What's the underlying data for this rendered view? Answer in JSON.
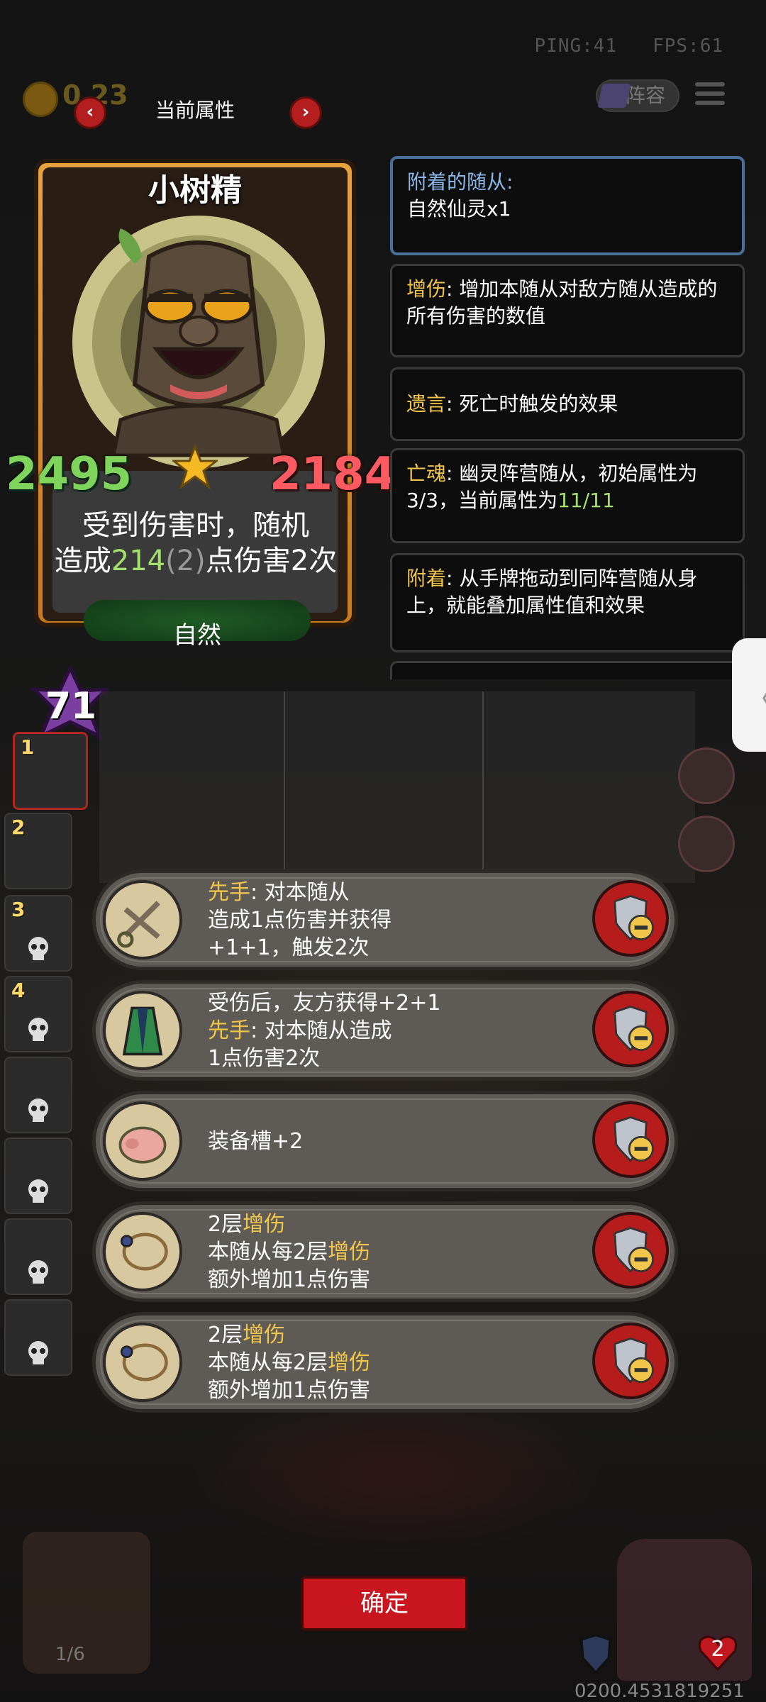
{
  "status": {
    "ping": "PING:41",
    "fps": "FPS:61",
    "coins": "0 23"
  },
  "header": {
    "title": "当前属性",
    "prev_arrow": "‹",
    "next_arrow": "›",
    "lineup": "阵容"
  },
  "card": {
    "name": "小树精",
    "desc_line1": "受到伤害时，随机",
    "desc_pre": "造成",
    "desc_dmg": "214",
    "desc_base": "(2)",
    "desc_post": "点伤害2次",
    "attack": "2495",
    "health": "2184",
    "tribe": "自然",
    "level": "71",
    "star_count": 1
  },
  "keywords": [
    {
      "key": "附着的随从:",
      "text": "自然仙灵x1"
    },
    {
      "key": "增伤",
      "text": ": 增加本随从对敌方随从造成的所有伤害的数值"
    },
    {
      "key": "遗言",
      "text": ": 死亡时触发的效果"
    },
    {
      "key": "亡魂",
      "text": ": 幽灵阵营随从，初始属性为3/3，当前属性为",
      "value": "11/11"
    },
    {
      "key": "附着",
      "text": ": 从手牌拖动到同阵营随从身上，就能叠加属性值和效果"
    }
  ],
  "side_tab": "〈",
  "slots": [
    "1",
    "2",
    "3",
    "4",
    "",
    "",
    "",
    ""
  ],
  "equipment": [
    {
      "icon": "scissors-icon",
      "l1k": "先手",
      "l1": ": 对本随从",
      "l2": "造成1点伤害并获得",
      "l3": "+1+1，触发2次"
    },
    {
      "icon": "robe-icon",
      "l1k": "",
      "l1": "受伤后，友方获得+2+1",
      "l2k": "先手",
      "l2": ": 对本随从造成",
      "l3": "1点伤害2次"
    },
    {
      "icon": "pig-icon",
      "l1k": "",
      "l1": "装备槽+2"
    },
    {
      "icon": "necklace-icon",
      "l1": "2层",
      "l1k2": "增伤",
      "l2": "本随从每2层",
      "l2k2": "增伤",
      "l3": "额外增加1点伤害"
    },
    {
      "icon": "necklace-icon",
      "l1": "2层",
      "l1k2": "增伤",
      "l2": "本随从每2层",
      "l2k2": "增伤",
      "l3": "额外增加1点伤害"
    }
  ],
  "footer": {
    "confirm": "确定",
    "deck_count": "1/6",
    "coords": "0200.4531819251",
    "hero_hp": "2"
  },
  "colors": {
    "attack": "#7fd45c",
    "health": "#ff5a62",
    "keyword": "#f2c64b",
    "confirm": "#c8151e"
  }
}
